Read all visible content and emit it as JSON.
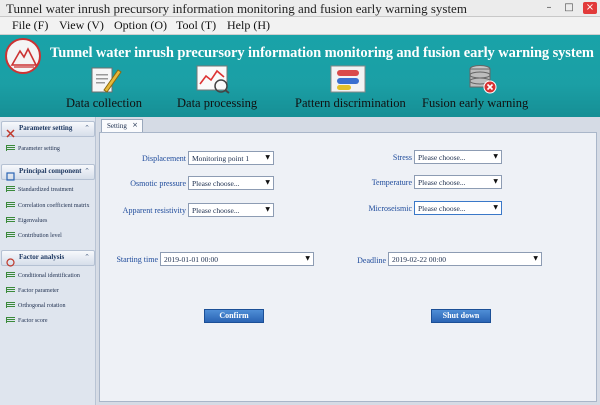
{
  "window": {
    "title": "Tunnel water inrush precursory information monitoring and fusion early warning system",
    "controls": [
      "–",
      "□",
      "×"
    ]
  },
  "menu": [
    "File (F)",
    "View (V)",
    "Option (O)",
    "Tool (T)",
    "Help (H)"
  ],
  "banner": {
    "app_title": "Tunnel water inrush precursory information monitoring and fusion early warning system",
    "modules": [
      {
        "label": "Data collection",
        "icon": "clipboard-pen-icon"
      },
      {
        "label": "Data processing",
        "icon": "chart-analysis-icon"
      },
      {
        "label": "Pattern discrimination",
        "icon": "capsule-cards-icon"
      },
      {
        "label": "Fusion early warning",
        "icon": "database-warning-icon"
      }
    ]
  },
  "sidebar": {
    "sections": [
      {
        "title": "Parameter setting",
        "items": [
          "Parameter setting"
        ]
      },
      {
        "title": "Principal component",
        "items": [
          "Standardized treatment",
          "Correlation coefficient matrix",
          "Eigenvalues",
          "Contribution level"
        ]
      },
      {
        "title": "Factor analysis",
        "items": [
          "Conditional identification",
          "Factor parameter",
          "Orthogonal rotation",
          "Factor score"
        ]
      }
    ],
    "chevron": "⌃"
  },
  "tab": {
    "label": "Setting",
    "close": "×"
  },
  "form": {
    "displacement": {
      "label": "Displacement",
      "value": "Monitoring point 1"
    },
    "osmotic_pressure": {
      "label": "Osmotic pressure",
      "value": "Please choose..."
    },
    "apparent_resistivity": {
      "label": "Apparent resistivity",
      "value": "Please choose..."
    },
    "stress": {
      "label": "Stress",
      "value": "Please choose..."
    },
    "temperature": {
      "label": "Temperature",
      "value": "Please choose..."
    },
    "microseismic": {
      "label": "Microseismic",
      "value": "Please choose..."
    },
    "starting_time": {
      "label": "Starting time",
      "value": "2019-01-01 00:00"
    },
    "deadline": {
      "label": "Deadline",
      "value": "2019-02-22 00:00"
    },
    "arrow": "▼"
  },
  "buttons": {
    "confirm": "Confirm",
    "shutdown": "Shut down"
  },
  "colors": {
    "banner": "#19a3a8",
    "label_blue": "#1d4a9b",
    "button_blue": "#2a64b4"
  }
}
